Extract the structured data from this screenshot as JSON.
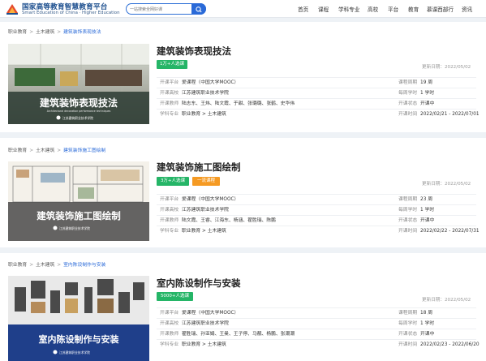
{
  "header": {
    "logo_cn": "国家高等教育智慧教育平台",
    "logo_en": "Smart Education of China · Higher Education",
    "search_placeholder": "一站搜索全网好课",
    "nav": [
      "首页",
      "课程",
      "学科专业",
      "高校",
      "平台",
      "教育",
      "慕课西部行",
      "资讯"
    ]
  },
  "courses": [
    {
      "breadcrumb": [
        "职业教育",
        "土木建筑",
        "建筑装饰表现技法"
      ],
      "thumb_title": "建筑装饰表现技法",
      "thumb_subtitle": "Architectural decoration performance techniques",
      "thumb_school": "江苏建筑职业技术学院",
      "title": "建筑装饰表现技法",
      "badges": [
        "1万+人选课"
      ],
      "updated": "更新日期：2022/05/02",
      "rows": [
        {
          "k": "开课平台",
          "v": "爱课程（中国大学MOOC）",
          "k2": "课程周期",
          "v2": "19 周"
        },
        {
          "k": "开课高校",
          "v": "江苏建筑职业技术学院",
          "k2": "每周学时",
          "v2": "1 学时"
        },
        {
          "k": "开课教师",
          "v": "陆志东、王炜、陆文霞、于甜、张璐璐、张鹤、史华伟",
          "k2": "开课状态",
          "v2": "开课中"
        },
        {
          "k": "学科专业",
          "v": "职业教育  >  土木建筑",
          "k2": "开课时间",
          "v2": "2022/02/21 - 2022/07/01"
        }
      ]
    },
    {
      "breadcrumb": [
        "职业教育",
        "土木建筑",
        "建筑装饰施工图绘制"
      ],
      "thumb_title": "建筑装饰施工图绘制",
      "thumb_subtitle": "",
      "thumb_school": "江苏建筑职业技术学院",
      "title": "建筑装饰施工图绘制",
      "badges": [
        "3万+人选课",
        "一流课程"
      ],
      "updated": "更新日期：2022/05/02",
      "rows": [
        {
          "k": "开课平台",
          "v": "爱课程（中国大学MOOC）",
          "k2": "课程周期",
          "v2": "23 周"
        },
        {
          "k": "开课高校",
          "v": "江苏建筑职业技术学院",
          "k2": "每周学时",
          "v2": "1 学时"
        },
        {
          "k": "开课教师",
          "v": "陆文霞、王睿、江海东、杨涵、翟胜瑞、陈鹏",
          "k2": "开课状态",
          "v2": "开课中"
        },
        {
          "k": "学科专业",
          "v": "职业教育  >  土木建筑",
          "k2": "开课时间",
          "v2": "2022/02/22 - 2022/07/31"
        }
      ]
    },
    {
      "breadcrumb": [
        "职业教育",
        "土木建筑",
        "室内陈设制作与安装"
      ],
      "thumb_title": "室内陈设制作与安装",
      "thumb_subtitle": "",
      "thumb_school": "江苏建筑职业技术学院",
      "title": "室内陈设制作与安装",
      "badges": [
        "5000+人选课"
      ],
      "updated": "更新日期：2022/05/02",
      "rows": [
        {
          "k": "开课平台",
          "v": "爱课程（中国大学MOOC）",
          "k2": "课程周期",
          "v2": "18 周"
        },
        {
          "k": "开课高校",
          "v": "江苏建筑职业技术学院",
          "k2": "每周学时",
          "v2": "1 学时"
        },
        {
          "k": "开课教师",
          "v": "翟胜瑞、孙亚娟、王曼、王子停、马靓、杨鹏、张潮潮",
          "k2": "开课状态",
          "v2": "开课中"
        },
        {
          "k": "学科专业",
          "v": "职业教育  >  土木建筑",
          "k2": "开课时间",
          "v2": "2022/02/23 - 2022/06/20"
        }
      ]
    }
  ],
  "colors": {
    "brand": "#1d4f8f",
    "search": "#2a6ad8",
    "green": "#25b567",
    "orange": "#f59a23"
  }
}
